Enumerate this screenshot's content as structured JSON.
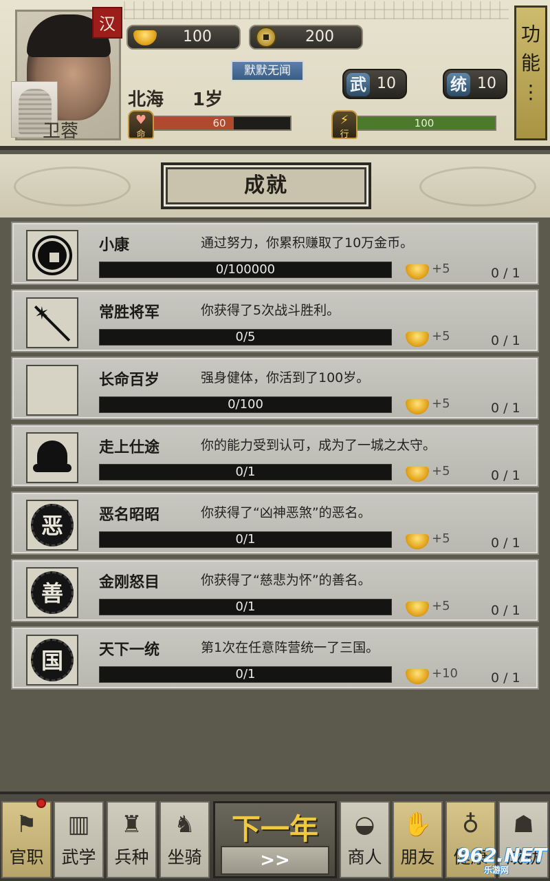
{
  "header": {
    "faction": "汉",
    "spouse_name": "卫蓉",
    "currency": {
      "ingot": "100",
      "coin": "200"
    },
    "title_badge": "默默无闻",
    "place": "北海",
    "age": "1岁",
    "stats": [
      {
        "label": "武",
        "value": "10"
      },
      {
        "label": "统",
        "value": "10"
      }
    ],
    "life": {
      "tag": "命",
      "value": "60",
      "fraction": 0.6,
      "color": "#b04a2e"
    },
    "action": {
      "tag": "行",
      "value": "100",
      "fraction": 1.0,
      "color": "#4b7a2a"
    },
    "func_button": [
      "功",
      "能",
      "⋮"
    ]
  },
  "page": {
    "title": "成就"
  },
  "achievements": [
    {
      "name": "小康",
      "desc": "通过努力，你累积赚取了10万金币。",
      "progress": "0/100000",
      "reward": "+5",
      "count": "0 / 1",
      "icon": "coin-icon"
    },
    {
      "name": "常胜将军",
      "desc": "你获得了5次战斗胜利。",
      "progress": "0/5",
      "reward": "+5",
      "count": "0 / 1",
      "icon": "spear-icon"
    },
    {
      "name": "长命百岁",
      "desc": "强身健体，你活到了100岁。",
      "progress": "0/100",
      "reward": "+5",
      "count": "0 / 1",
      "icon": "heart-icon"
    },
    {
      "name": "走上仕途",
      "desc": "你的能力受到认可，成为了一城之太守。",
      "progress": "0/1",
      "reward": "+5",
      "count": "0 / 1",
      "icon": "official-hat-icon"
    },
    {
      "name": "恶名昭昭",
      "desc": "你获得了“凶神恶煞”的恶名。",
      "progress": "0/1",
      "reward": "+5",
      "count": "0 / 1",
      "icon": "evil-seal-icon",
      "seal": "恶"
    },
    {
      "name": "金刚怒目",
      "desc": "你获得了“慈悲为怀”的善名。",
      "progress": "0/1",
      "reward": "+5",
      "count": "0 / 1",
      "icon": "good-seal-icon",
      "seal": "善"
    },
    {
      "name": "天下一统",
      "desc": "第1次在任意阵营统一了三国。",
      "progress": "0/1",
      "reward": "+10",
      "count": "0 / 1",
      "icon": "unify-seal-icon",
      "seal": "国"
    }
  ],
  "nav": {
    "items": [
      {
        "label": "官职",
        "icon": "official-icon"
      },
      {
        "label": "武学",
        "icon": "martial-icon"
      },
      {
        "label": "兵种",
        "icon": "helmet-icon"
      },
      {
        "label": "坐骑",
        "icon": "horse-icon"
      },
      {
        "label": "商人",
        "icon": "ingot-icon"
      },
      {
        "label": "朋友",
        "icon": "handshake-icon"
      },
      {
        "label": "健康",
        "icon": "gourd-icon"
      },
      {
        "label": "成就",
        "icon": "map-icon"
      }
    ],
    "next_year": "下一年",
    "fast_forward": ">>"
  },
  "watermark": {
    "brand": "962.NET",
    "sub": "乐游网"
  }
}
